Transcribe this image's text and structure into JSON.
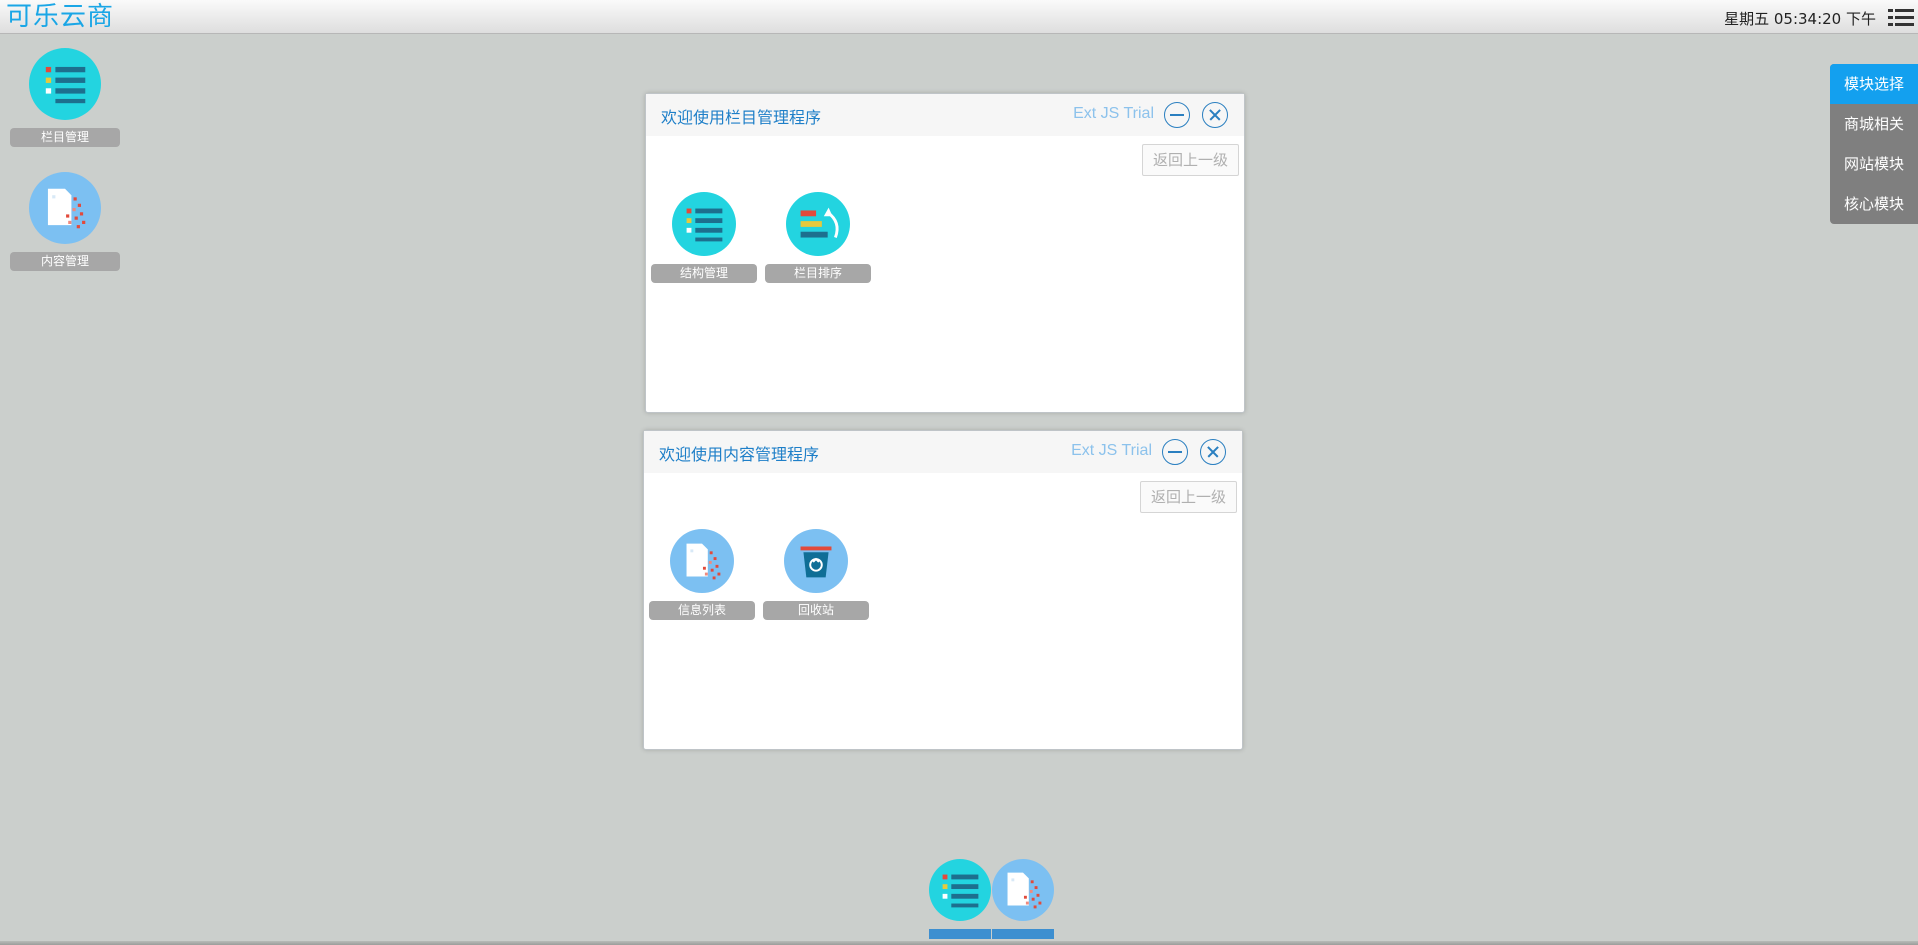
{
  "topbar": {
    "logo": "可乐云商",
    "clock": "星期五 05:34:20 下午"
  },
  "desktop": {
    "shortcuts": [
      {
        "label": "栏目管理",
        "icon": "list-icon"
      },
      {
        "label": "内容管理",
        "icon": "document-shred-icon"
      }
    ]
  },
  "windows": [
    {
      "title": "欢迎使用栏目管理程序",
      "trial": "Ext JS Trial",
      "back_label": "返回上一级",
      "apps": [
        {
          "label": "结构管理",
          "icon": "list-icon"
        },
        {
          "label": "栏目排序",
          "icon": "sort-icon"
        }
      ]
    },
    {
      "title": "欢迎使用内容管理程序",
      "trial": "Ext JS Trial",
      "back_label": "返回上一级",
      "apps": [
        {
          "label": "信息列表",
          "icon": "document-shred-icon"
        },
        {
          "label": "回收站",
          "icon": "recycle-bin-icon"
        }
      ]
    }
  ],
  "module_menu": {
    "items": [
      "模块选择",
      "商城相关",
      "网站模块",
      "核心模块"
    ],
    "active": "模块选择"
  },
  "taskbar": {
    "items": [
      {
        "icon": "list-icon"
      },
      {
        "icon": "document-shred-icon"
      }
    ]
  },
  "colors": {
    "teal": "#23d4e0",
    "blue": "#7cc0f2",
    "accent": "#13a0ef",
    "title": "#1e7fc8"
  }
}
